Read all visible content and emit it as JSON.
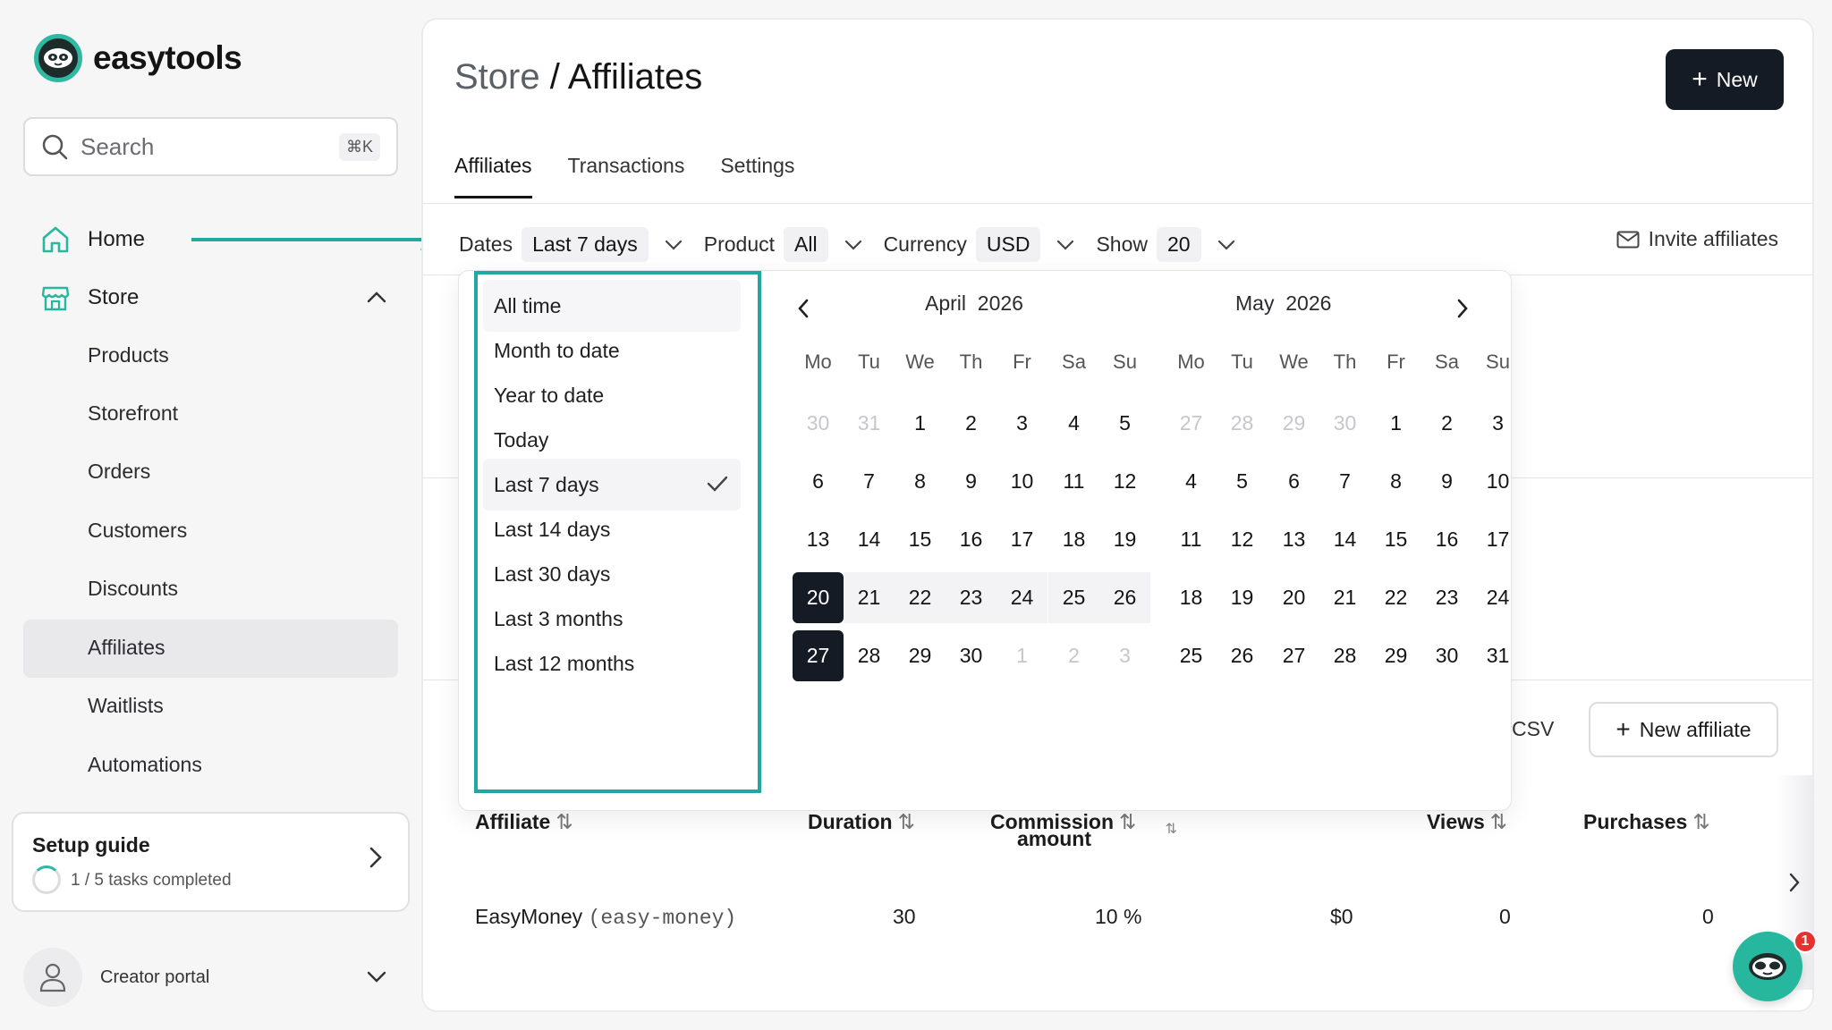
{
  "app": {
    "brand": "easytools",
    "colors": {
      "accent": "#2fb8a2",
      "highlight_border": "#23a7a3",
      "primary_button": "#141b24",
      "badge": "#e5322e"
    }
  },
  "sidebar": {
    "search_placeholder": "Search",
    "search_shortcut": "⌘K",
    "home": "Home",
    "store": "Store",
    "store_items": [
      "Products",
      "Storefront",
      "Orders",
      "Customers",
      "Discounts",
      "Affiliates",
      "Waitlists",
      "Automations"
    ],
    "active_item": "Affiliates",
    "setup_guide": {
      "title": "Setup guide",
      "progress": "1 / 5 tasks completed",
      "completed": 1,
      "total": 5
    },
    "portal": "Creator portal"
  },
  "header": {
    "breadcrumb_parent": "Store",
    "breadcrumb_sep": "/",
    "breadcrumb_current": "Affiliates",
    "new_button": "New"
  },
  "tabs": [
    {
      "label": "Affiliates",
      "active": true
    },
    {
      "label": "Transactions",
      "active": false
    },
    {
      "label": "Settings",
      "active": false
    }
  ],
  "filters": {
    "dates_label": "Dates",
    "dates_value": "Last 7 days",
    "product_label": "Product",
    "product_value": "All",
    "currency_label": "Currency",
    "currency_value": "USD",
    "show_label": "Show",
    "show_value": "20",
    "invite": "Invite affiliates"
  },
  "date_presets": [
    "All time",
    "Month to date",
    "Year to date",
    "Today",
    "Last 7 days",
    "Last 14 days",
    "Last 30 days",
    "Last 3 months",
    "Last 12 months"
  ],
  "selected_preset": "Last 7 days",
  "calendars": [
    {
      "month": "April",
      "year": "2026",
      "weekdays": [
        "Mo",
        "Tu",
        "We",
        "Th",
        "Fr",
        "Sa",
        "Su"
      ],
      "weeks": [
        [
          "30",
          "31",
          "1",
          "2",
          "3",
          "4",
          "5"
        ],
        [
          "6",
          "7",
          "8",
          "9",
          "10",
          "11",
          "12"
        ],
        [
          "13",
          "14",
          "15",
          "16",
          "17",
          "18",
          "19"
        ],
        [
          "20",
          "21",
          "22",
          "23",
          "24",
          "25",
          "26"
        ],
        [
          "27",
          "28",
          "29",
          "30",
          "1",
          "2",
          "3"
        ]
      ]
    },
    {
      "month": "May",
      "year": "2026",
      "weekdays": [
        "Mo",
        "Tu",
        "We",
        "Th",
        "Fr",
        "Sa",
        "Su"
      ],
      "weeks": [
        [
          "27",
          "28",
          "29",
          "30",
          "1",
          "2",
          "3"
        ],
        [
          "4",
          "5",
          "6",
          "7",
          "8",
          "9",
          "10"
        ],
        [
          "11",
          "12",
          "13",
          "14",
          "15",
          "16",
          "17"
        ],
        [
          "18",
          "19",
          "20",
          "21",
          "22",
          "23",
          "24"
        ],
        [
          "25",
          "26",
          "27",
          "28",
          "29",
          "30",
          "31"
        ]
      ]
    }
  ],
  "toolbar": {
    "csv": "CSV",
    "new_affiliate": "New affiliate"
  },
  "table": {
    "columns": [
      "Affiliate",
      "Duration",
      "Commission",
      "Commission amount",
      "Views",
      "Purchases"
    ],
    "commission_amount_visible": "amount",
    "sort_glyph": "⇅",
    "rows": [
      {
        "name": "EasyMoney",
        "slug": "(easy-money)",
        "duration": "30",
        "commission": "10 %",
        "commission_amount": "$0",
        "views": "0",
        "purchases": "0"
      }
    ]
  },
  "chat": {
    "badge": "1"
  }
}
